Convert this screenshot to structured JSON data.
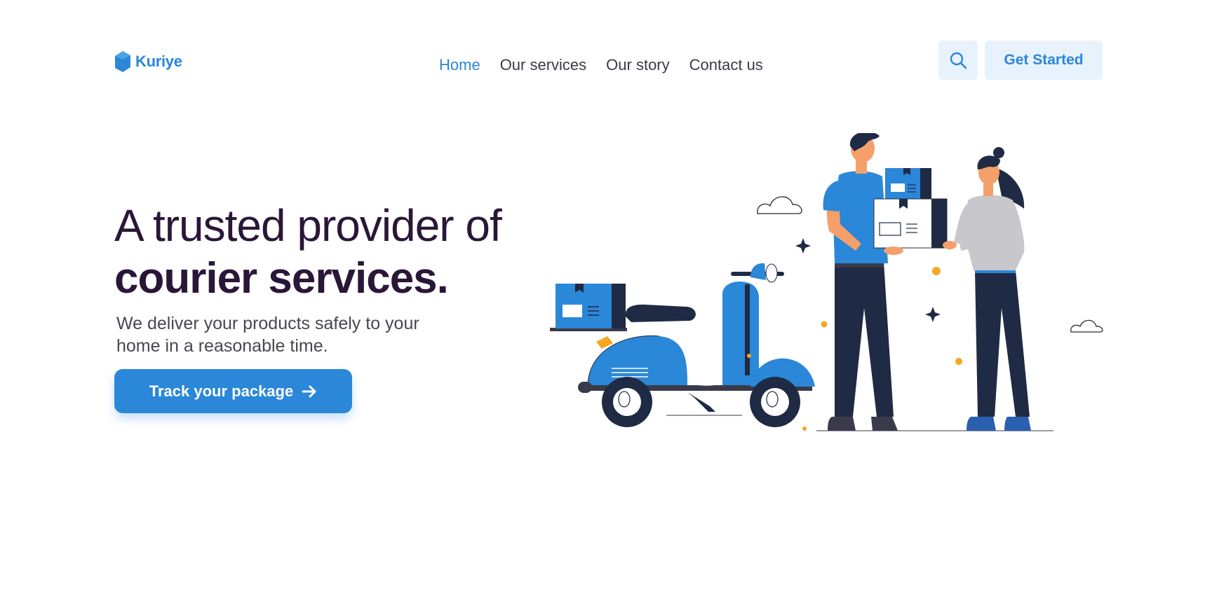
{
  "brand": {
    "name": "Kuriye",
    "accent_color": "#2b87d8",
    "dark_color": "#2a1738"
  },
  "nav": {
    "items": [
      {
        "label": "Home",
        "active": true
      },
      {
        "label": "Our services",
        "active": false
      },
      {
        "label": "Our story",
        "active": false
      },
      {
        "label": "Contact us",
        "active": false
      }
    ]
  },
  "header": {
    "search_icon": "search-icon",
    "cta_label": "Get Started"
  },
  "hero": {
    "title_line_1": "A trusted provider of",
    "title_line_2": "courier services.",
    "subtitle": "We deliver your products safely to your home in a reasonable time.",
    "button_label": "Track your package",
    "button_icon": "arrow-right-icon"
  },
  "illustration": {
    "description_icon": "delivery-illustration"
  }
}
